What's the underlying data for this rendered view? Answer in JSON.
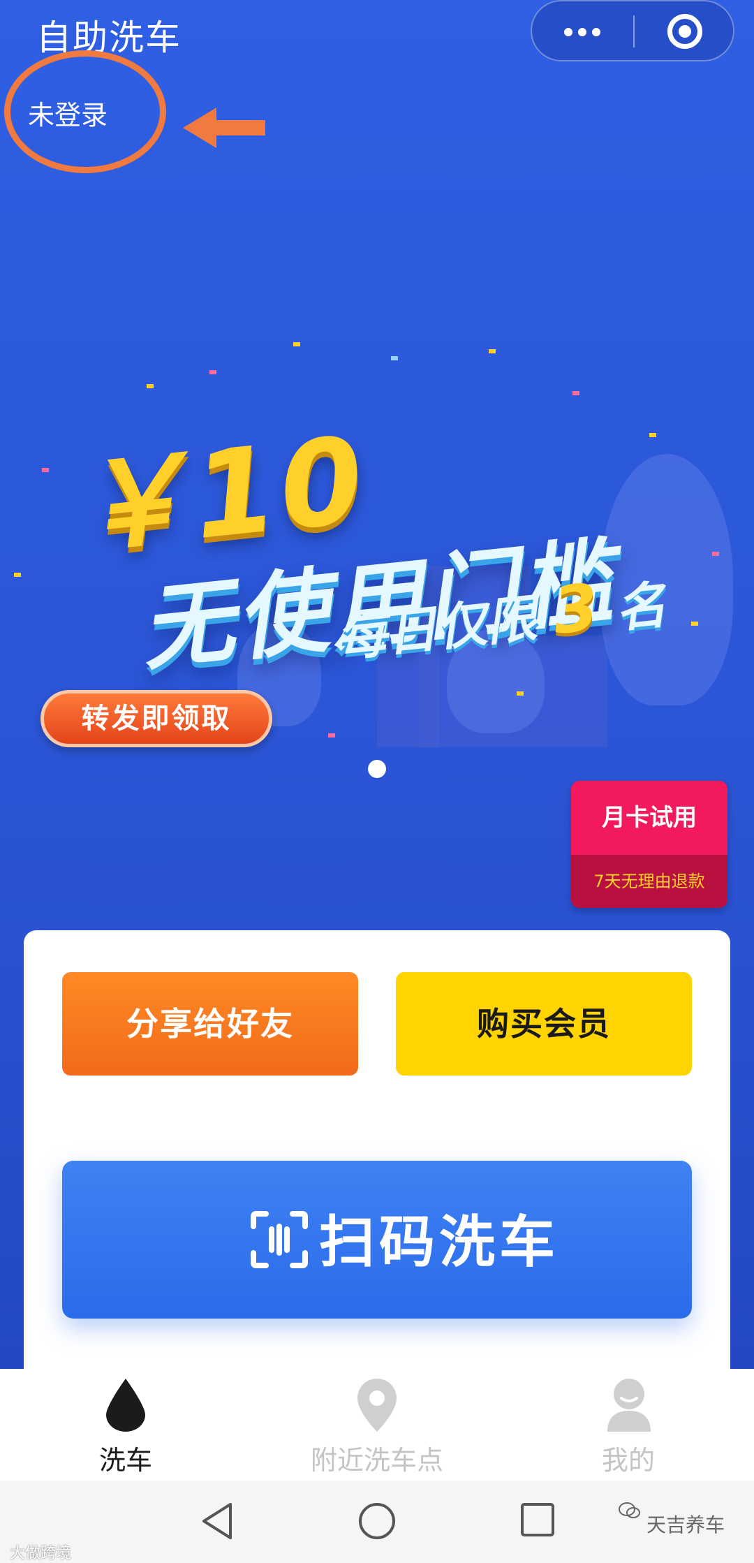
{
  "header": {
    "title": "自助洗车",
    "login_status": "未登录"
  },
  "banner": {
    "amount": "￥10",
    "headline": "无使用门槛",
    "subline_prefix": "每日仅限",
    "subline_num": "3",
    "subline_suffix": "名",
    "cta": "转发即领取"
  },
  "month_card": {
    "title": "月卡试用",
    "note": "7天无理由退款"
  },
  "actions": {
    "share": "分享给好友",
    "vip": "购买会员",
    "scan": "扫码洗车"
  },
  "tabs": [
    {
      "label": "洗车",
      "icon": "water-drop-icon",
      "active": true
    },
    {
      "label": "附近洗车点",
      "icon": "location-pin-icon",
      "active": false
    },
    {
      "label": "我的",
      "icon": "user-avatar-icon",
      "active": false
    }
  ],
  "watermarks": {
    "left": "大做跨境",
    "right": "天吉养车"
  },
  "colors": {
    "primary_blue": "#2f5fe3",
    "orange": "#f26a1b",
    "yellow": "#ffd400",
    "pink": "#f2195d",
    "annotation": "#f07a3f"
  }
}
